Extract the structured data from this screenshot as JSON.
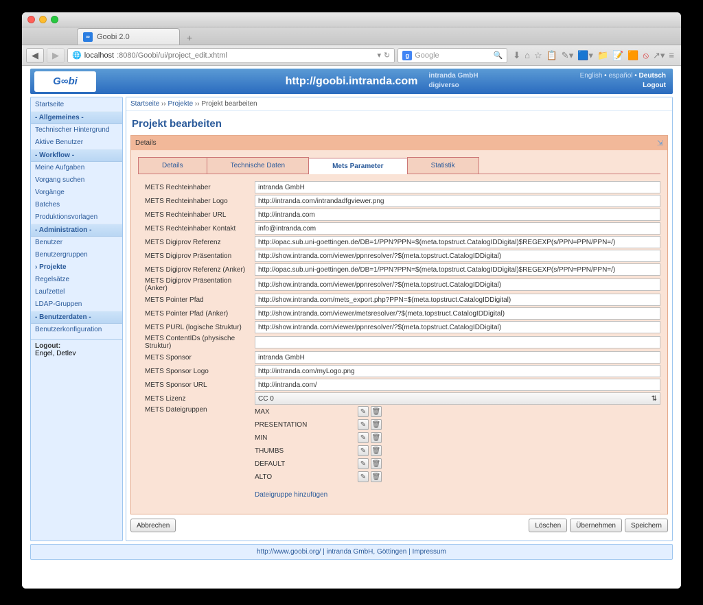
{
  "browser": {
    "tab_title": "Goobi 2.0",
    "url_host": "localhost",
    "url_path": ":8080/Goobi/ui/project_edit.xhtml",
    "search_placeholder": "Google"
  },
  "header": {
    "center_url": "http://goobi.intranda.com",
    "company1": "intranda GmbH",
    "company2": "digiverso",
    "lang1": "English",
    "lang2": "español",
    "lang3": "Deutsch",
    "logout": "Logout"
  },
  "sidebar": {
    "start": "Startseite",
    "sec1": "- Allgemeines -",
    "s1a": "Technischer Hintergrund",
    "s1b": "Aktive Benutzer",
    "sec2": "- Workflow -",
    "s2a": "Meine Aufgaben",
    "s2b": "Vorgang suchen",
    "s2c": "Vorgänge",
    "s2d": "Batches",
    "s2e": "Produktionsvorlagen",
    "sec3": "- Administration -",
    "s3a": "Benutzer",
    "s3b": "Benutzergruppen",
    "s3c": "› Projekte",
    "s3d": "Regelsätze",
    "s3e": "Laufzettel",
    "s3f": "LDAP-Gruppen",
    "sec4": "- Benutzerdaten -",
    "s4a": "Benutzerkonfiguration",
    "logout_label": "Logout:",
    "user": "Engel, Detlev"
  },
  "crumbs": [
    "Startseite",
    "Projekte",
    "Projekt bearbeiten"
  ],
  "main": {
    "title": "Projekt bearbeiten",
    "panel_title": "Details",
    "tabs": [
      "Details",
      "Technische Daten",
      "Mets Parameter",
      "Statistik"
    ]
  },
  "form": {
    "fields": [
      {
        "label": "METS Rechteinhaber",
        "value": "intranda GmbH"
      },
      {
        "label": "METS Rechteinhaber Logo",
        "value": "http://intranda.com/intrandadfgviewer.png"
      },
      {
        "label": "METS Rechteinhaber URL",
        "value": "http://intranda.com"
      },
      {
        "label": "METS Rechteinhaber Kontakt",
        "value": "info@intranda.com"
      },
      {
        "label": "METS Digiprov Referenz",
        "value": "http://opac.sub.uni-goettingen.de/DB=1/PPN?PPN=$(meta.topstruct.CatalogIDDigital)$REGEXP(s/PPN=PPN/PPN=/)"
      },
      {
        "label": "METS Digiprov Präsentation",
        "value": "http://show.intranda.com/viewer/ppnresolver/?$(meta.topstruct.CatalogIDDigital)"
      },
      {
        "label": "METS Digiprov Referenz (Anker)",
        "value": "http://opac.sub.uni-goettingen.de/DB=1/PPN?PPN=$(meta.topstruct.CatalogIDDigital)$REGEXP(s/PPN=PPN/PPN=/)"
      },
      {
        "label": "METS Digiprov Präsentation (Anker)",
        "value": "http://show.intranda.com/viewer/ppnresolver/?$(meta.topstruct.CatalogIDDigital)"
      },
      {
        "label": "METS Pointer Pfad",
        "value": "http://show.intranda.com/mets_export.php?PPN=$(meta.topstruct.CatalogIDDigital)"
      },
      {
        "label": "METS Pointer Pfad (Anker)",
        "value": "http://show.intranda.com/viewer/metsresolver/?$(meta.topstruct.CatalogIDDigital)"
      },
      {
        "label": "METS PURL (logische Struktur)",
        "value": "http://show.intranda.com/viewer/ppnresolver/?$(meta.topstruct.CatalogIDDigital)"
      },
      {
        "label": "METS ContentIDs (physische Struktur)",
        "value": ""
      },
      {
        "label": "METS Sponsor",
        "value": "intranda GmbH"
      },
      {
        "label": "METS Sponsor Logo",
        "value": "http://intranda.com/myLogo.png"
      },
      {
        "label": "METS Sponsor URL",
        "value": "http://intranda.com/"
      }
    ],
    "license_label": "METS Lizenz",
    "license_value": "CC 0",
    "filegroups_label": "METS Dateigruppen",
    "filegroups": [
      "MAX",
      "PRESENTATION",
      "MIN",
      "THUMBS",
      "DEFAULT",
      "ALTO"
    ],
    "add_filegroup": "Dateigruppe hinzufügen"
  },
  "buttons": {
    "cancel": "Abbrechen",
    "delete": "Löschen",
    "apply": "Übernehmen",
    "save": "Speichern"
  },
  "footer": {
    "link1": "http://www.goobi.org/",
    "company": "intranda GmbH, Göttingen",
    "impressum": "Impressum"
  }
}
